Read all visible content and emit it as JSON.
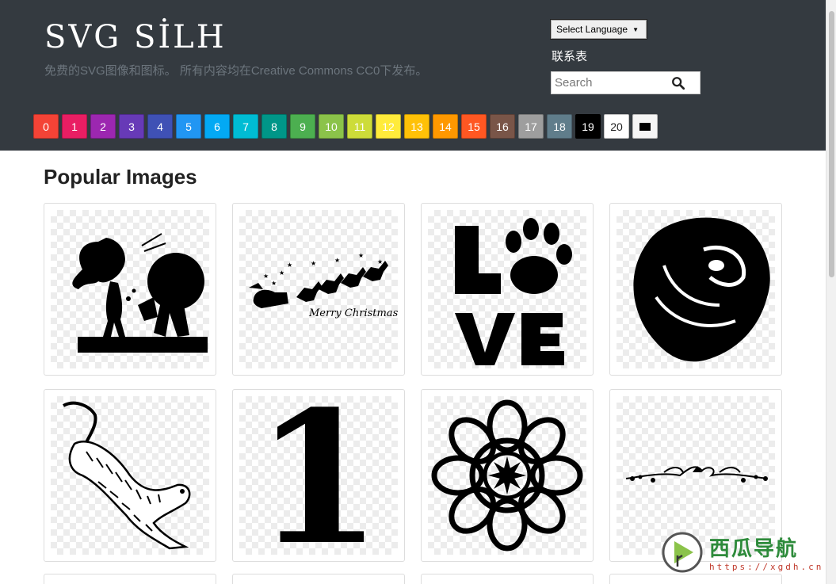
{
  "header": {
    "logo": "SVG SİLH",
    "tagline": "免费的SVG图像和图标。 所有内容均在Creative Commons CC0下发布。",
    "language_label": "Select Language",
    "contact_label": "联系表",
    "search_placeholder": "Search"
  },
  "swatches": [
    {
      "label": "0",
      "color": "#f44336"
    },
    {
      "label": "1",
      "color": "#e91e63"
    },
    {
      "label": "2",
      "color": "#9c27b0"
    },
    {
      "label": "3",
      "color": "#673ab7"
    },
    {
      "label": "4",
      "color": "#3f51b5"
    },
    {
      "label": "5",
      "color": "#2196f3"
    },
    {
      "label": "6",
      "color": "#03a9f4"
    },
    {
      "label": "7",
      "color": "#00bcd4"
    },
    {
      "label": "8",
      "color": "#009688"
    },
    {
      "label": "9",
      "color": "#4caf50"
    },
    {
      "label": "10",
      "color": "#8bc34a"
    },
    {
      "label": "11",
      "color": "#cddc39"
    },
    {
      "label": "12",
      "color": "#ffeb3b"
    },
    {
      "label": "13",
      "color": "#ffc107"
    },
    {
      "label": "14",
      "color": "#ff9800"
    },
    {
      "label": "15",
      "color": "#ff5722"
    },
    {
      "label": "16",
      "color": "#795548"
    },
    {
      "label": "17",
      "color": "#9e9e9e"
    },
    {
      "label": "18",
      "color": "#607d8b"
    },
    {
      "label": "19",
      "color": "#000000"
    },
    {
      "label": "20",
      "color": "#ffffff"
    }
  ],
  "main": {
    "section_title": "Popular Images",
    "images": [
      {
        "icon": "couple-silhouette"
      },
      {
        "icon": "santa-sleigh-merry-christmas",
        "text": "Merry Christmas"
      },
      {
        "icon": "love-paw",
        "text": "LOVE"
      },
      {
        "icon": "rose-silhouette"
      },
      {
        "icon": "tiger-drawing"
      },
      {
        "icon": "number-one",
        "text": "1"
      },
      {
        "icon": "mandala"
      },
      {
        "icon": "ornamental-divider"
      }
    ]
  },
  "watermark": {
    "title": "西瓜导航",
    "url": "https://xgdh.cn"
  }
}
